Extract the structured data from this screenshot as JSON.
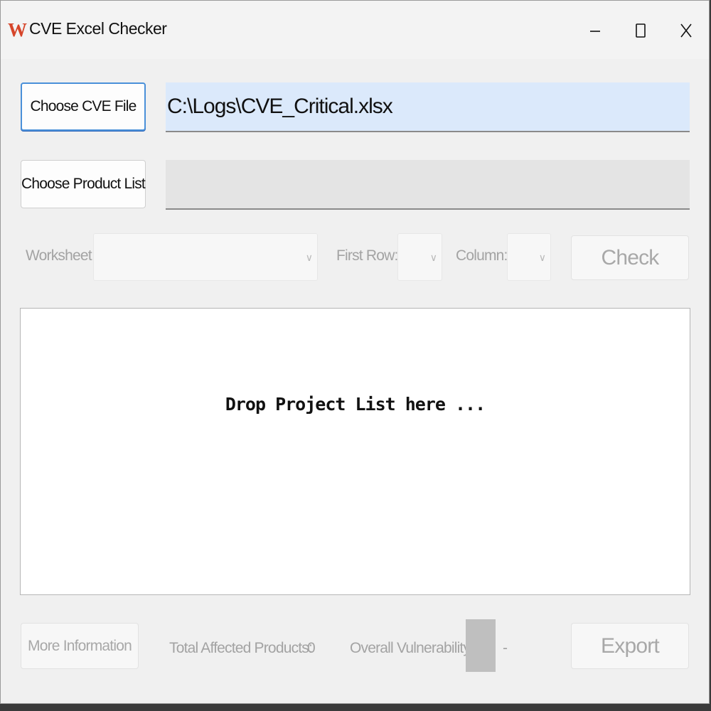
{
  "window": {
    "title": "CVE Excel Checker",
    "icon_char": "W",
    "accent_color": "#d6452a"
  },
  "controls": {
    "minimize_icon": "minimize-icon",
    "maximize_icon": "maximize-icon",
    "close_icon": "close-icon"
  },
  "cve": {
    "button_label": "Choose CVE File",
    "path": "C:\\Logs\\CVE_Critical.xlsx"
  },
  "product": {
    "button_label": "Choose Product List",
    "path": ""
  },
  "options": {
    "worksheet_label": "Worksheet",
    "worksheet_value": "",
    "first_row_label": "First Row:",
    "first_row_value": "",
    "column_label": "Column:",
    "column_value": "",
    "check_label": "Check"
  },
  "drop": {
    "text": "Drop Project List here ..."
  },
  "footer": {
    "more_info_label": "More Information",
    "total_affected_label": "Total Affected Products:",
    "total_affected_value": "0",
    "overall_vuln_label": "Overall Vulnerability:",
    "overall_vuln_value": "-",
    "export_label": "Export"
  }
}
